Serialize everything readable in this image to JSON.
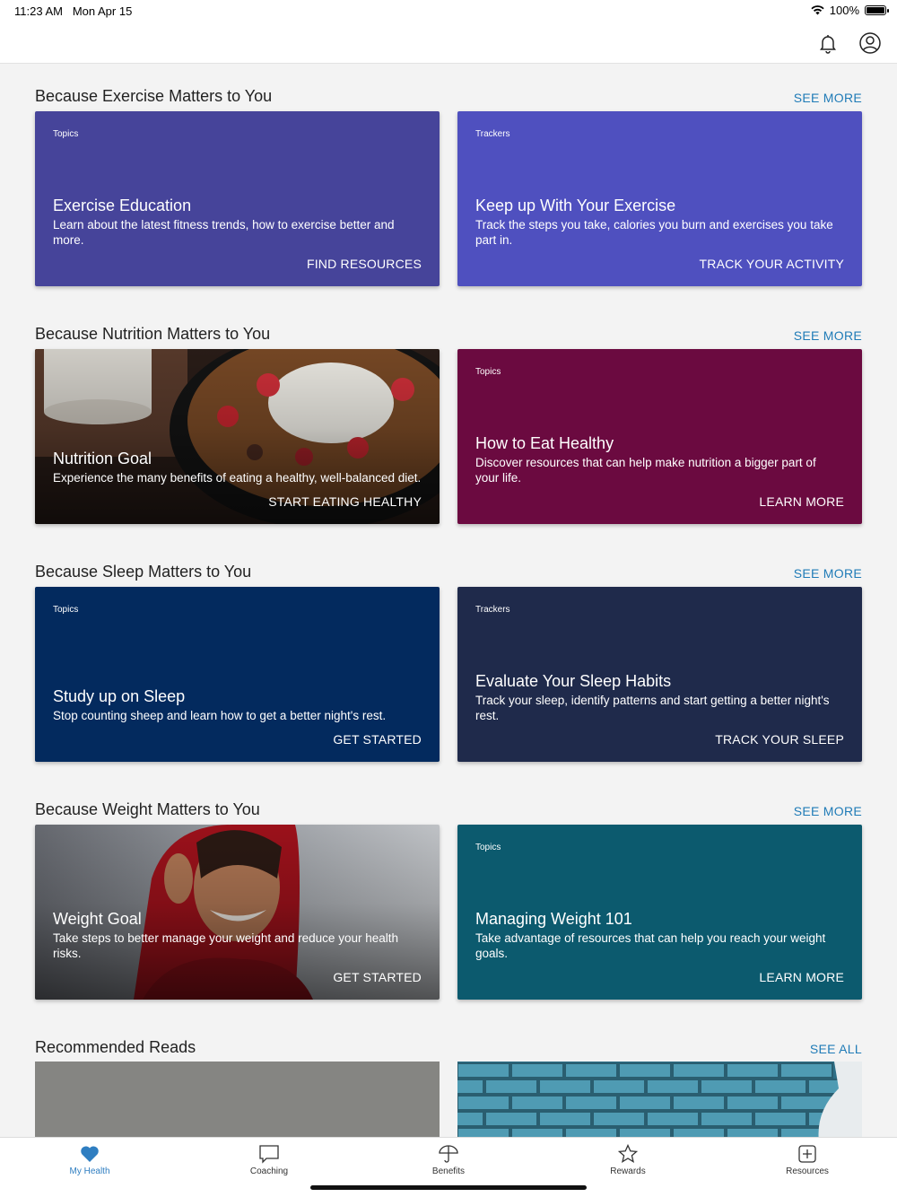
{
  "status": {
    "time": "11:23 AM",
    "date": "Mon Apr 15",
    "battery": "100%"
  },
  "header": {
    "bell_icon": "bell-icon",
    "profile_icon": "user-circle-icon"
  },
  "sections": [
    {
      "title": "Because Exercise Matters to You",
      "see_more": "SEE MORE",
      "cards": [
        {
          "kind": "Topics",
          "title": "Exercise Education",
          "desc": "Learn about the latest fitness trends, how to exercise better and more.",
          "cta": "FIND RESOURCES",
          "color": "#46449a"
        },
        {
          "kind": "Trackers",
          "title": "Keep up With Your Exercise",
          "desc": "Track the steps you take, calories you burn and exercises you take part in.",
          "cta": "TRACK YOUR ACTIVITY",
          "color": "#4f50bf"
        }
      ]
    },
    {
      "title": "Because Nutrition Matters to You",
      "see_more": "SEE MORE",
      "cards": [
        {
          "kind": "",
          "title": "Nutrition Goal",
          "desc": "Experience the many benefits of eating a healthy, well-balanced diet.",
          "cta": "START EATING HEALTHY",
          "color": "#3b2a22"
        },
        {
          "kind": "Topics",
          "title": "How to Eat Healthy",
          "desc": "Discover resources that can help make nutrition a bigger part of your life.",
          "cta": "LEARN MORE",
          "color": "#6b0a40"
        }
      ]
    },
    {
      "title": "Because Sleep Matters to You",
      "see_more": "SEE MORE",
      "cards": [
        {
          "kind": "Topics",
          "title": "Study up on Sleep",
          "desc": "Stop counting sheep and learn how to get a better night's rest.",
          "cta": "GET STARTED",
          "color": "#032a5e"
        },
        {
          "kind": "Trackers",
          "title": "Evaluate Your Sleep Habits",
          "desc": "Track your sleep, identify patterns and start getting a better night's rest.",
          "cta": "TRACK YOUR SLEEP",
          "color": "#1f2a4b"
        }
      ]
    },
    {
      "title": "Because Weight Matters to You",
      "see_more": "SEE MORE",
      "cards": [
        {
          "kind": "",
          "title": "Weight Goal",
          "desc": "Take steps to better manage your weight and reduce your health risks.",
          "cta": "GET STARTED",
          "color": "#7a2a2e"
        },
        {
          "kind": "Topics",
          "title": "Managing Weight 101",
          "desc": "Take advantage of resources that can help you reach your weight goals.",
          "cta": "LEARN MORE",
          "color": "#0c5a6e"
        }
      ]
    }
  ],
  "recommended": {
    "title": "Recommended Reads",
    "see_all": "SEE ALL"
  },
  "tabs": [
    {
      "label": "My Health",
      "icon": "heart-icon",
      "active": true
    },
    {
      "label": "Coaching",
      "icon": "chat-bubble-icon",
      "active": false
    },
    {
      "label": "Benefits",
      "icon": "umbrella-icon",
      "active": false
    },
    {
      "label": "Rewards",
      "icon": "star-icon",
      "active": false
    },
    {
      "label": "Resources",
      "icon": "plus-box-icon",
      "active": false
    }
  ]
}
